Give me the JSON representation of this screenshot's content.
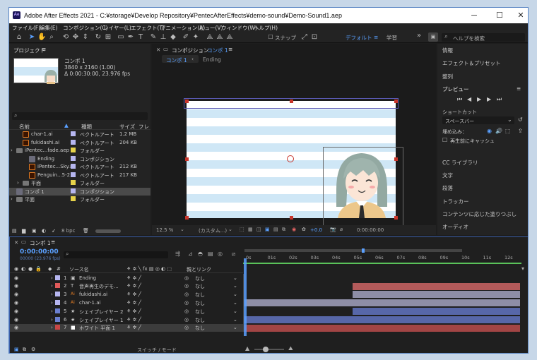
{
  "app": {
    "logo": "Ae",
    "title": "Adobe After Effects 2021 - C:¥storage¥Develop Repository¥PentecAfterEffects¥demo-sound¥Demo-Sound1.aep",
    "controls": [
      "─",
      "☐",
      "✕"
    ]
  },
  "menu": [
    "ファイル(F)",
    "編集(E)",
    "コンポジション(C)",
    "レイヤー(L)",
    "エフェクト(T)",
    "アニメーション(A)",
    "ビュー(V)",
    "ウィンドウ(W)",
    "ヘルプ(H)"
  ],
  "toolbar": {
    "snap_label": "スナップ",
    "workspace_default": "デフォルト",
    "workspace_learn": "学習",
    "more": "»",
    "search_placeholder": "ヘルプを検索"
  },
  "project": {
    "title": "プロジェクト",
    "menu_icon": "≡",
    "preview_name": "コンポ 1",
    "preview_dims": "3840 x 2160 (1.00)",
    "preview_duration": "Δ 0:00:30:00, 23.976 fps",
    "search_placeholder": "",
    "col_name": "名前",
    "col_type": "種類",
    "col_size": "サイズ",
    "col_frame": "フレ",
    "items": [
      {
        "indent": 1,
        "icon": "ai",
        "name": "char-1.ai",
        "color": "#b6b6f0",
        "type": "ベクトルアート",
        "size": "1.2 MB"
      },
      {
        "indent": 1,
        "icon": "ai",
        "name": "fukidashi.ai",
        "color": "#b6b6f0",
        "type": "ベクトルアート",
        "size": "204 KB"
      },
      {
        "indent": 0,
        "icon": "folder",
        "name": "iPentec...fade.aep",
        "color": "#e6d24a",
        "type": "フォルダー",
        "size": ""
      },
      {
        "indent": 2,
        "icon": "comp",
        "name": "Ending",
        "color": "#b6b6f0",
        "type": "コンポジション",
        "size": ""
      },
      {
        "indent": 2,
        "icon": "ai",
        "name": "iPentec...Sky.ai",
        "color": "#b6b6f0",
        "type": "ベクトルアート",
        "size": "212 KB"
      },
      {
        "indent": 2,
        "icon": "ai",
        "name": "Penguin...5-2.ai",
        "color": "#b6b6f0",
        "type": "ベクトルアート",
        "size": "217 KB"
      },
      {
        "indent": 1,
        "icon": "folder",
        "name": "平面",
        "color": "#e6d24a",
        "type": "フォルダー",
        "size": ""
      },
      {
        "indent": 0,
        "icon": "comp",
        "name": "コンポ 1",
        "color": "#b6b6f0",
        "type": "コンポジション",
        "size": "",
        "selected": true
      },
      {
        "indent": 0,
        "icon": "folder",
        "name": "平面",
        "color": "#e6d24a",
        "type": "フォルダー",
        "size": ""
      }
    ],
    "bpc": "8 bpc"
  },
  "composition": {
    "panel_title": "コンポジション",
    "panel_comp": "コンポ 1",
    "menu_icon": "≡",
    "crumb_active": "コンポ 1",
    "crumb_next": "Ending",
    "zoom": "12.5 %",
    "camera": "(カスタム...)",
    "exposure": "+0.0",
    "timecode": "0:00:00:00"
  },
  "right_panels": [
    "情報",
    "エフェクト＆プリセット",
    "整列"
  ],
  "preview": {
    "title": "プレビュー",
    "menu_icon": "≡",
    "shortcut_label": "ショートカット",
    "shortcut_value": "スペースバー",
    "include_label": "埋め込み：",
    "cache_label": "再生前にキャッシュ"
  },
  "right_panels_lower": [
    "CC ライブラリ",
    "文字",
    "段落",
    "トラッカー",
    "コンテンツに応じた塗りつぶし",
    "オーディオ"
  ],
  "timeline": {
    "tab": "コンポ 1",
    "menu_icon": "≡",
    "timecode": "0:00:00:00",
    "timecode_sub": "00000 (23.976 fps)",
    "col_source": "ソース名",
    "col_parent": "親とリンク",
    "ruler": [
      "0s",
      "01s",
      "02s",
      "03s",
      "04s",
      "05s",
      "06s",
      "07s",
      "08s",
      "09s",
      "10s",
      "11s",
      "12s"
    ],
    "footer_toggle": "スイッチ / モード",
    "layers": [
      {
        "num": "1",
        "color": "#b6b6f0",
        "icon": "comp",
        "name": "Ending",
        "parent": "なし",
        "bar_start_s": 0,
        "bar_color": "#3a3a3a",
        "has_bar": false
      },
      {
        "num": "2",
        "color": "#e05a5a",
        "icon": "T",
        "name": "音声再生のデモ...",
        "parent": "なし",
        "bar_start_s": 5,
        "bar_color": "#b35a5a",
        "has_bar": true
      },
      {
        "num": "3",
        "color": "#b6b6f0",
        "icon": "ai",
        "name": "fukidashi.ai",
        "parent": "なし",
        "bar_start_s": 5,
        "bar_color": "#8e8ea6",
        "has_bar": true
      },
      {
        "num": "4",
        "color": "#b6b6f0",
        "icon": "ai",
        "name": "char-1.ai",
        "parent": "なし",
        "bar_start_s": 0,
        "bar_color": "#8e8ea6",
        "has_bar": true
      },
      {
        "num": "5",
        "color": "#6a7fd0",
        "icon": "star",
        "name": "シェイプレイヤー 2",
        "parent": "なし",
        "bar_start_s": 5,
        "bar_color": "#5767a8",
        "has_bar": true
      },
      {
        "num": "6",
        "color": "#6a7fd0",
        "icon": "star",
        "name": "シェイプレイヤー 1",
        "parent": "なし",
        "bar_start_s": 0,
        "bar_color": "#5767a8",
        "has_bar": true
      },
      {
        "num": "7",
        "color": "#c84646",
        "icon": "solid",
        "name": "ホワイト 平面 1",
        "parent": "なし",
        "bar_start_s": 0,
        "bar_color": "#a24545",
        "has_bar": true,
        "selected": true
      }
    ]
  }
}
